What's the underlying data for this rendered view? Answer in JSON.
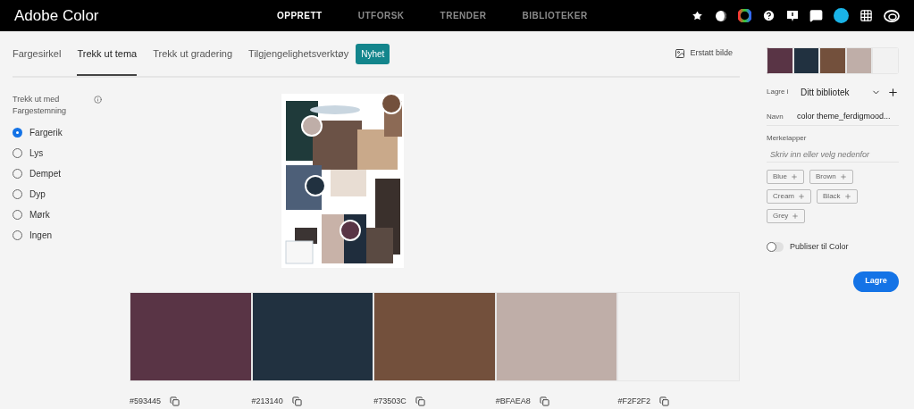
{
  "app_title": "Adobe Color",
  "nav": [
    {
      "label": "OPPRETT",
      "selected": true
    },
    {
      "label": "UTFORSK",
      "selected": false
    },
    {
      "label": "TRENDER",
      "selected": false
    },
    {
      "label": "BIBLIOTEKER",
      "selected": false
    }
  ],
  "tabs": [
    {
      "label": "Fargesirkel",
      "selected": false
    },
    {
      "label": "Trekk ut tema",
      "selected": true
    },
    {
      "label": "Trekk ut gradering",
      "selected": false
    },
    {
      "label": "Tilgjengelighetsverktøy",
      "selected": false
    }
  ],
  "new_badge": "Nyhet",
  "replace_image": "Erstatt bilde",
  "mood": {
    "title": "Trekk ut med Fargestemning",
    "options": [
      {
        "label": "Fargerik",
        "selected": true
      },
      {
        "label": "Lys",
        "selected": false
      },
      {
        "label": "Dempet",
        "selected": false
      },
      {
        "label": "Dyp",
        "selected": false
      },
      {
        "label": "Mørk",
        "selected": false
      },
      {
        "label": "Ingen",
        "selected": false
      }
    ]
  },
  "swatches": [
    {
      "hex": "#593445",
      "color": "#593445"
    },
    {
      "hex": "#213140",
      "color": "#213140"
    },
    {
      "hex": "#73503C",
      "color": "#73503c"
    },
    {
      "hex": "#BFAEA8",
      "color": "#bfaea8"
    },
    {
      "hex": "#F2F2F2",
      "color": "#f2f2f2"
    }
  ],
  "save_panel": {
    "library_label": "Lagre i",
    "library": "Ditt bibliotek",
    "name_label": "Navn",
    "name_value": "color theme_ferdigmood...",
    "tags_label": "Merkelapper",
    "tags_placeholder": "Skriv inn eller velg nedenfor",
    "tags": [
      "Blue",
      "Brown",
      "Cream",
      "Black",
      "Grey"
    ],
    "publish": {
      "label": "Publiser til Color",
      "on": false
    },
    "save_button": "Lagre"
  }
}
